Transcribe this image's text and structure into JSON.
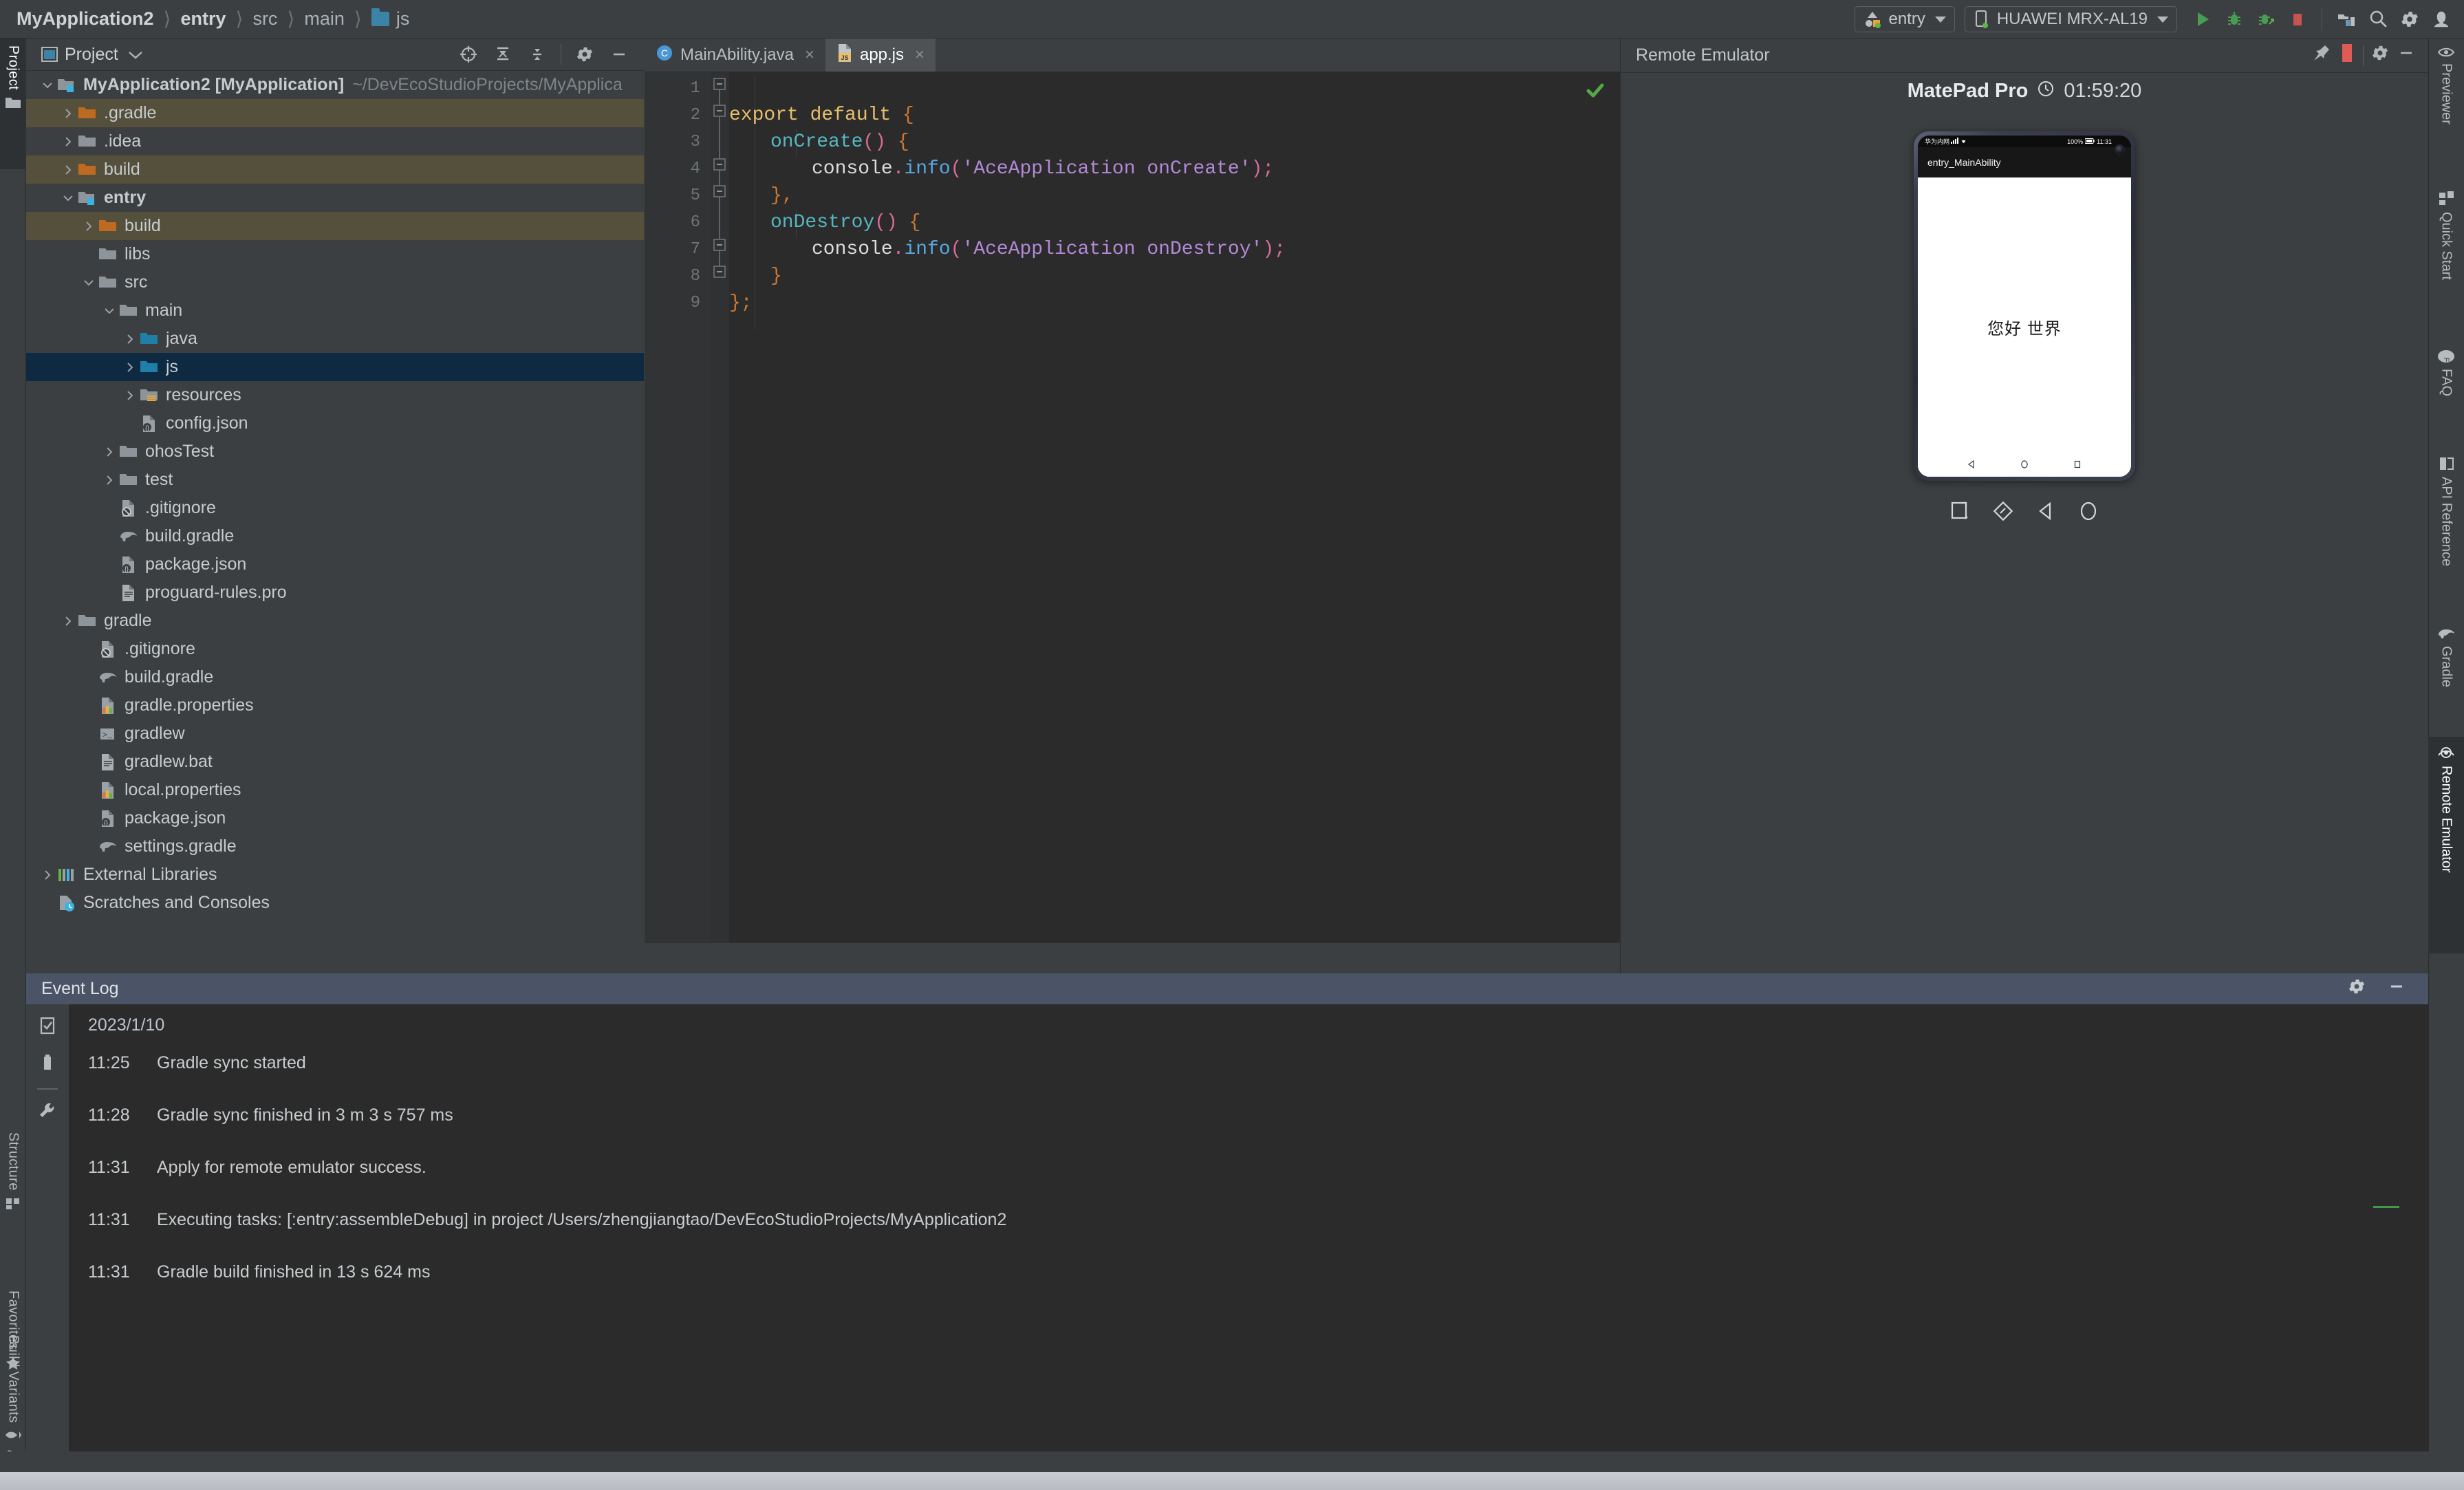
{
  "breadcrumb": {
    "items": [
      "MyApplication2",
      "entry",
      "src",
      "main",
      "js"
    ],
    "folder_icon": "folder-icon"
  },
  "toolbar": {
    "run_config_label": "entry",
    "device_label": "HUAWEI MRX-AL19",
    "icons": [
      "run-icon",
      "debug-icon",
      "attach-debugger-icon",
      "stop-icon",
      "project-structure-icon",
      "search-icon",
      "settings-icon",
      "account-icon"
    ],
    "accent_green": "#499c54",
    "accent_red": "#c75450"
  },
  "left_rail": {
    "top_tabs": [
      {
        "label": "Project",
        "icon": "project-folder-icon",
        "active": true
      }
    ],
    "bottom_tabs": [
      {
        "label": "Structure",
        "icon": "structure-icon"
      },
      {
        "label": "Favorites",
        "icon": "star-icon"
      },
      {
        "label": "Build Variants",
        "icon": "build-variants-icon"
      }
    ]
  },
  "project_panel": {
    "title": "Project",
    "header_icons": [
      "locate-icon",
      "collapse-all-icon",
      "expand-all-icon",
      "settings-icon",
      "minimize-icon"
    ],
    "tree": [
      {
        "depth": 0,
        "label": "MyApplication2 [MyApplication]",
        "suffix": "~/DevEcoStudioProjects/MyApplica",
        "arrow": "down",
        "icon": "module-folder-icon",
        "bold": true,
        "state": "normal"
      },
      {
        "depth": 1,
        "label": ".gradle",
        "arrow": "right",
        "icon": "excluded-folder-icon",
        "state": "excluded"
      },
      {
        "depth": 1,
        "label": ".idea",
        "arrow": "right",
        "icon": "folder-icon",
        "state": "normal"
      },
      {
        "depth": 1,
        "label": "build",
        "arrow": "right",
        "icon": "excluded-folder-icon",
        "state": "excluded"
      },
      {
        "depth": 1,
        "label": "entry",
        "arrow": "down",
        "icon": "module-folder-icon",
        "bold": true,
        "state": "normal"
      },
      {
        "depth": 2,
        "label": "build",
        "arrow": "right",
        "icon": "excluded-folder-icon",
        "state": "excluded"
      },
      {
        "depth": 2,
        "label": "libs",
        "arrow": "none",
        "icon": "folder-icon",
        "state": "normal"
      },
      {
        "depth": 2,
        "label": "src",
        "arrow": "down",
        "icon": "folder-icon",
        "state": "normal"
      },
      {
        "depth": 3,
        "label": "main",
        "arrow": "down",
        "icon": "folder-icon",
        "state": "normal"
      },
      {
        "depth": 4,
        "label": "java",
        "arrow": "right",
        "icon": "source-folder-icon",
        "state": "normal"
      },
      {
        "depth": 4,
        "label": "js",
        "arrow": "right",
        "icon": "source-folder-icon",
        "state": "selected"
      },
      {
        "depth": 4,
        "label": "resources",
        "arrow": "right",
        "icon": "resource-folder-icon",
        "state": "normal"
      },
      {
        "depth": 4,
        "label": "config.json",
        "arrow": "none",
        "icon": "json-file-icon",
        "state": "normal"
      },
      {
        "depth": 3,
        "label": "ohosTest",
        "arrow": "right",
        "icon": "folder-icon",
        "state": "normal"
      },
      {
        "depth": 3,
        "label": "test",
        "arrow": "right",
        "icon": "folder-icon",
        "state": "normal"
      },
      {
        "depth": 3,
        "label": ".gitignore",
        "arrow": "none",
        "icon": "gitignore-file-icon",
        "state": "normal"
      },
      {
        "depth": 3,
        "label": "build.gradle",
        "arrow": "none",
        "icon": "gradle-file-icon",
        "state": "normal"
      },
      {
        "depth": 3,
        "label": "package.json",
        "arrow": "none",
        "icon": "json-file-icon",
        "state": "normal"
      },
      {
        "depth": 3,
        "label": "proguard-rules.pro",
        "arrow": "none",
        "icon": "text-file-icon",
        "state": "normal"
      },
      {
        "depth": 1,
        "label": "gradle",
        "arrow": "right",
        "icon": "folder-icon",
        "state": "normal"
      },
      {
        "depth": 2,
        "label": ".gitignore",
        "arrow": "none",
        "icon": "gitignore-file-icon",
        "state": "normal"
      },
      {
        "depth": 2,
        "label": "build.gradle",
        "arrow": "none",
        "icon": "gradle-file-icon",
        "state": "normal"
      },
      {
        "depth": 2,
        "label": "gradle.properties",
        "arrow": "none",
        "icon": "properties-file-icon",
        "state": "normal"
      },
      {
        "depth": 2,
        "label": "gradlew",
        "arrow": "none",
        "icon": "shell-script-icon",
        "state": "normal"
      },
      {
        "depth": 2,
        "label": "gradlew.bat",
        "arrow": "none",
        "icon": "text-file-icon",
        "state": "normal"
      },
      {
        "depth": 2,
        "label": "local.properties",
        "arrow": "none",
        "icon": "properties-file-icon",
        "state": "normal"
      },
      {
        "depth": 2,
        "label": "package.json",
        "arrow": "none",
        "icon": "json-file-icon",
        "state": "normal"
      },
      {
        "depth": 2,
        "label": "settings.gradle",
        "arrow": "none",
        "icon": "gradle-file-icon",
        "state": "normal"
      },
      {
        "depth": 0,
        "label": "External Libraries",
        "arrow": "right",
        "icon": "libraries-icon",
        "state": "normal"
      },
      {
        "depth": 0,
        "label": "Scratches and Consoles",
        "arrow": "none",
        "icon": "scratches-icon",
        "state": "normal"
      }
    ]
  },
  "editor": {
    "tabs": [
      {
        "label": "MainAbility.java",
        "icon": "java-class-icon",
        "active": false,
        "close": "×"
      },
      {
        "label": "app.js",
        "icon": "js-file-icon",
        "active": true,
        "close": "×"
      }
    ],
    "line_numbers": [
      "1",
      "2",
      "3",
      "4",
      "5",
      "6",
      "7",
      "8",
      "9"
    ],
    "inspection_status_icon": "check-icon",
    "code": {
      "l1": {
        "a": "export default",
        "b": " {"
      },
      "l2": {
        "a": "onCreate",
        "b": "()",
        "c": " {"
      },
      "l3": {
        "a": "console",
        "b": ".",
        "c": "info",
        "d": "(",
        "e": "'AceApplication onCreate'",
        "f": ");"
      },
      "l4": {
        "a": "},"
      },
      "l5": {
        "a": "onDestroy",
        "b": "()",
        "c": " {"
      },
      "l6": {
        "a": "console",
        "b": ".",
        "c": "info",
        "d": "(",
        "e": "'AceApplication onDestroy'",
        "f": ");"
      },
      "l7": {
        "a": "}"
      },
      "l8": {
        "a": "};"
      }
    }
  },
  "emulator": {
    "panel_title": "Remote Emulator",
    "panel_icons": [
      "pin-icon",
      "stop-icon",
      "settings-icon",
      "minimize-icon"
    ],
    "device_name": "MatePad Pro",
    "countdown_icon": "clock-icon",
    "countdown": "01:59:20",
    "device": {
      "status_bar": {
        "carrier": "华为内网",
        "signal_icon": "signal-icon",
        "wifi_icon": "wifi-icon",
        "battery_text": "100%",
        "battery_icon": "battery-icon",
        "time": "11:31"
      },
      "app_bar_title": "entry_MainAbility",
      "content_text": "您好 世界",
      "nav_buttons": [
        "back-triangle-icon",
        "home-circle-icon",
        "recents-square-icon"
      ]
    },
    "controls": [
      "screenshot-icon",
      "rotate-icon",
      "back-icon",
      "home-icon"
    ]
  },
  "right_rail": {
    "tabs": [
      {
        "label": "Previewer",
        "icon": "eye-icon",
        "active": false
      },
      {
        "label": "Quick Start",
        "icon": "quick-start-icon",
        "active": false
      },
      {
        "label": "FAQ",
        "icon": "faq-icon",
        "active": false
      },
      {
        "label": "API Reference",
        "icon": "api-reference-icon",
        "active": false
      },
      {
        "label": "Gradle",
        "icon": "gradle-elephant-icon",
        "active": false
      },
      {
        "label": "Remote Emulator",
        "icon": "remote-emulator-icon",
        "active": true
      }
    ]
  },
  "event_log": {
    "title": "Event Log",
    "header_icons": [
      "settings-icon",
      "minimize-icon"
    ],
    "rail_icons": [
      "mark-read-icon",
      "delete-icon",
      "settings-wrench-icon"
    ],
    "date": "2023/1/10",
    "entries": [
      {
        "time": "11:25",
        "message": "Gradle sync started"
      },
      {
        "time": "11:28",
        "message": "Gradle sync finished in 3 m 3 s 757 ms"
      },
      {
        "time": "11:31",
        "message": "Apply for remote emulator success."
      },
      {
        "time": "11:31",
        "message": "Executing tasks: [:entry:assembleDebug] in project /Users/zhengjiangtao/DevEcoStudioProjects/MyApplication2"
      },
      {
        "time": "11:31",
        "message": "Gradle build finished in 13 s 624 ms"
      }
    ]
  }
}
